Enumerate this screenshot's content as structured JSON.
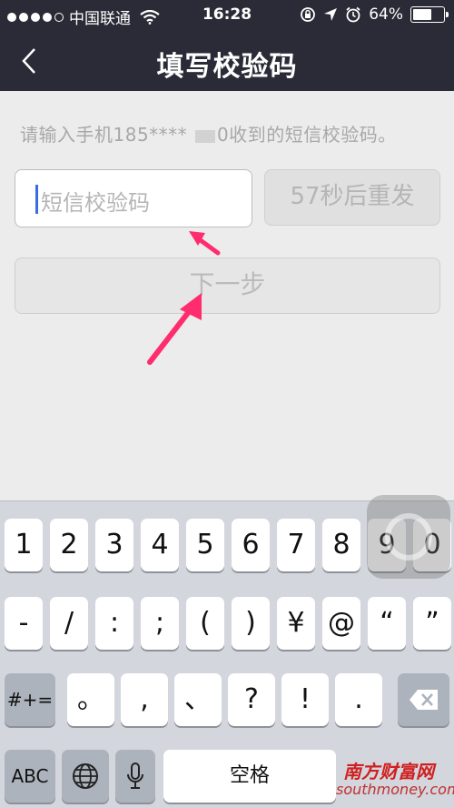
{
  "status_bar": {
    "carrier": "中国联通",
    "time": "16:28",
    "battery_pct": "64%",
    "battery_level": 0.64,
    "signal_dots_filled": 4,
    "signal_dots_total": 5
  },
  "nav": {
    "title": "填写校验码",
    "back_icon": "chevron-left-icon"
  },
  "content": {
    "hint_prefix": "请输入手机185**** ",
    "hint_suffix": "0收到的短信校验码。",
    "code_placeholder": "短信校验码",
    "resend_label": "57秒后重发",
    "next_label": "下一步"
  },
  "keyboard": {
    "row1": [
      "1",
      "2",
      "3",
      "4",
      "5",
      "6",
      "7",
      "8",
      "9",
      "0"
    ],
    "row2": [
      "-",
      "/",
      ":",
      ";",
      "(",
      ")",
      "¥",
      "@",
      "“",
      "”"
    ],
    "row3_left": "#+=",
    "row3": [
      "。",
      ",",
      "、",
      "?",
      "!",
      "."
    ],
    "row4_abc": "ABC",
    "space_label": "空格",
    "icons": [
      "globe-icon",
      "microphone-icon",
      "backspace-icon"
    ]
  },
  "watermark": {
    "title": "南方财富网",
    "url": "southmoney.com"
  },
  "colors": {
    "nav_bg": "#2b2b37",
    "annotation_arrow": "#ff2d6e",
    "caret": "#3a6de0"
  }
}
